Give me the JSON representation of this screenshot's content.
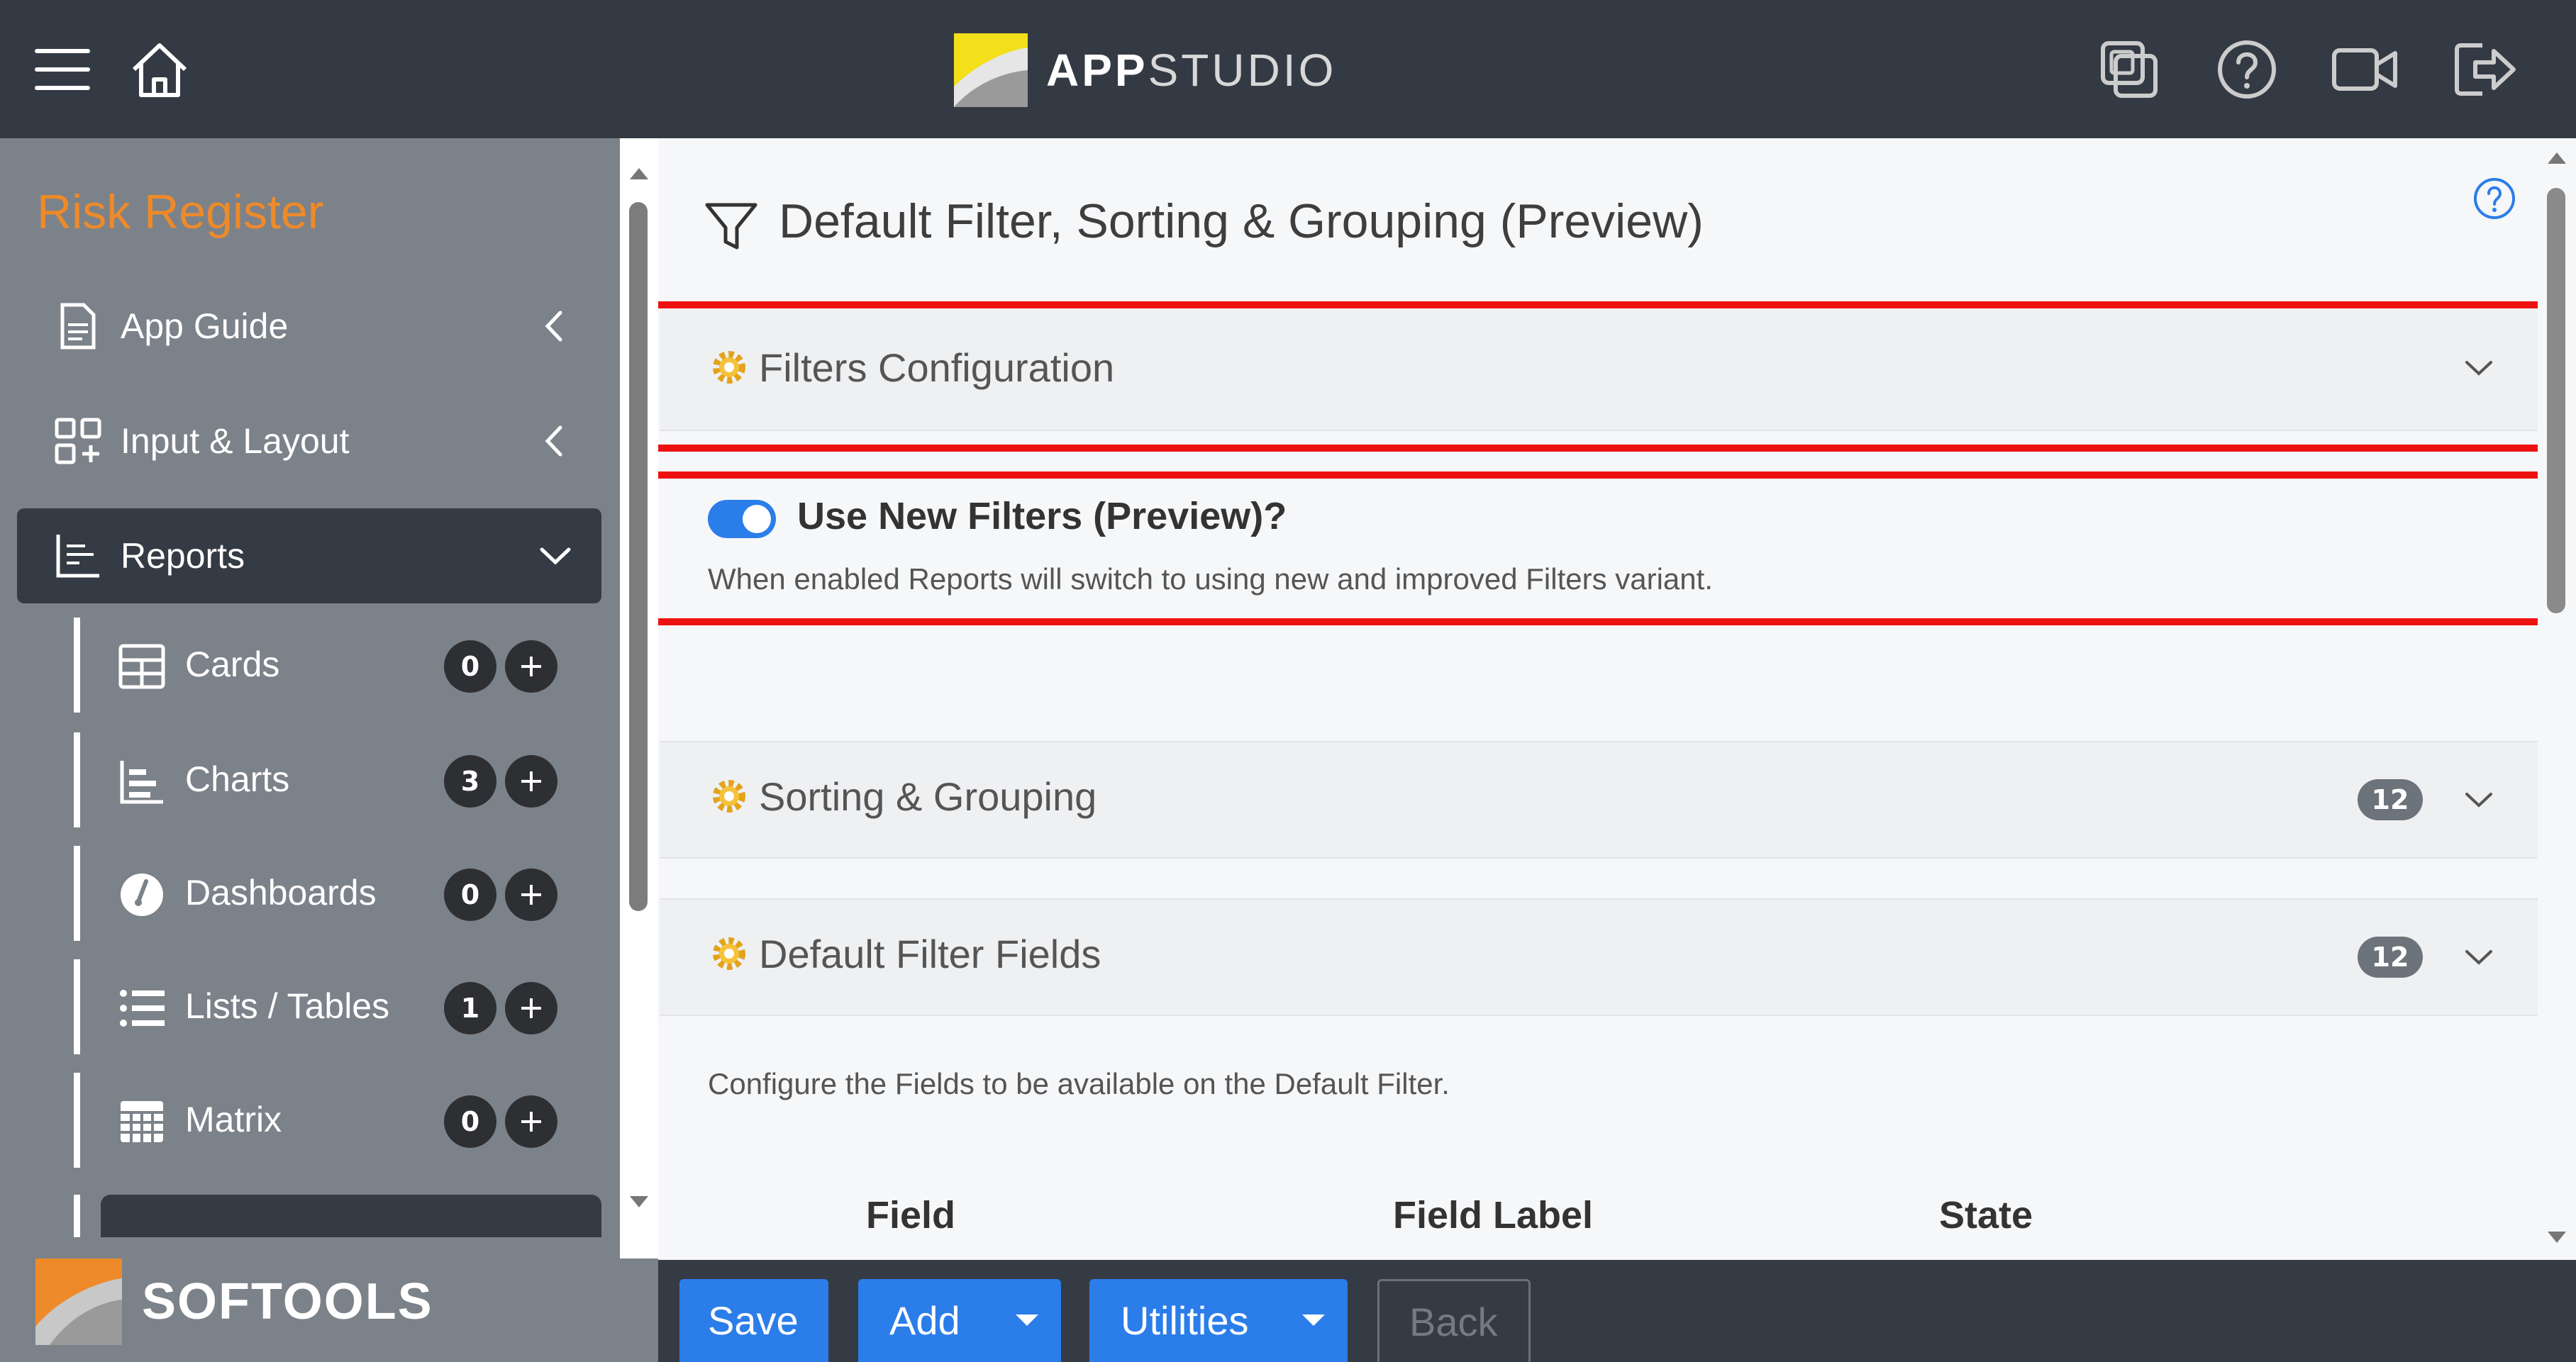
{
  "header": {
    "brand_strong": "APP",
    "brand_light": "STUDIO",
    "icons": [
      "menu-icon",
      "home-icon",
      "copy-icon",
      "help-icon",
      "video-icon",
      "logout-icon"
    ]
  },
  "sidebar": {
    "title": "Risk Register",
    "items": [
      {
        "label": "App Guide",
        "icon": "document-icon"
      },
      {
        "label": "Input & Layout",
        "icon": "layout-icon"
      },
      {
        "label": "Reports",
        "icon": "reports-icon"
      }
    ],
    "sub_items": [
      {
        "label": "Cards",
        "count": "0",
        "icon": "cards-icon"
      },
      {
        "label": "Charts",
        "count": "3",
        "icon": "chart-icon"
      },
      {
        "label": "Dashboards",
        "count": "0",
        "icon": "dashboard-icon"
      },
      {
        "label": "Lists / Tables",
        "count": "1",
        "icon": "list-icon"
      },
      {
        "label": "Matrix",
        "count": "0",
        "icon": "matrix-icon"
      }
    ],
    "footer_brand": "SOFTOOLS"
  },
  "main": {
    "title": "Default Filter, Sorting & Grouping (Preview)",
    "filters_config": {
      "label": "Filters Configuration"
    },
    "toggle": {
      "label": "Use New Filters (Preview)?",
      "description": "When enabled Reports will switch to using new and improved Filters variant.",
      "enabled": true
    },
    "sorting": {
      "label": "Sorting & Grouping",
      "count": "12"
    },
    "default_filter_fields": {
      "label": "Default Filter Fields",
      "count": "12",
      "description": "Configure the Fields to be available on the Default Filter."
    },
    "columns": [
      "Field",
      "Field Label",
      "State"
    ]
  },
  "toolbar": {
    "save": "Save",
    "add": "Add",
    "utilities": "Utilities",
    "back": "Back"
  },
  "colors": {
    "accent": "#2b7de9",
    "sidebar_title": "#ee8a2a",
    "highlight": "#ee1111",
    "topbar": "#343a44",
    "sidebar": "#7c8289"
  }
}
